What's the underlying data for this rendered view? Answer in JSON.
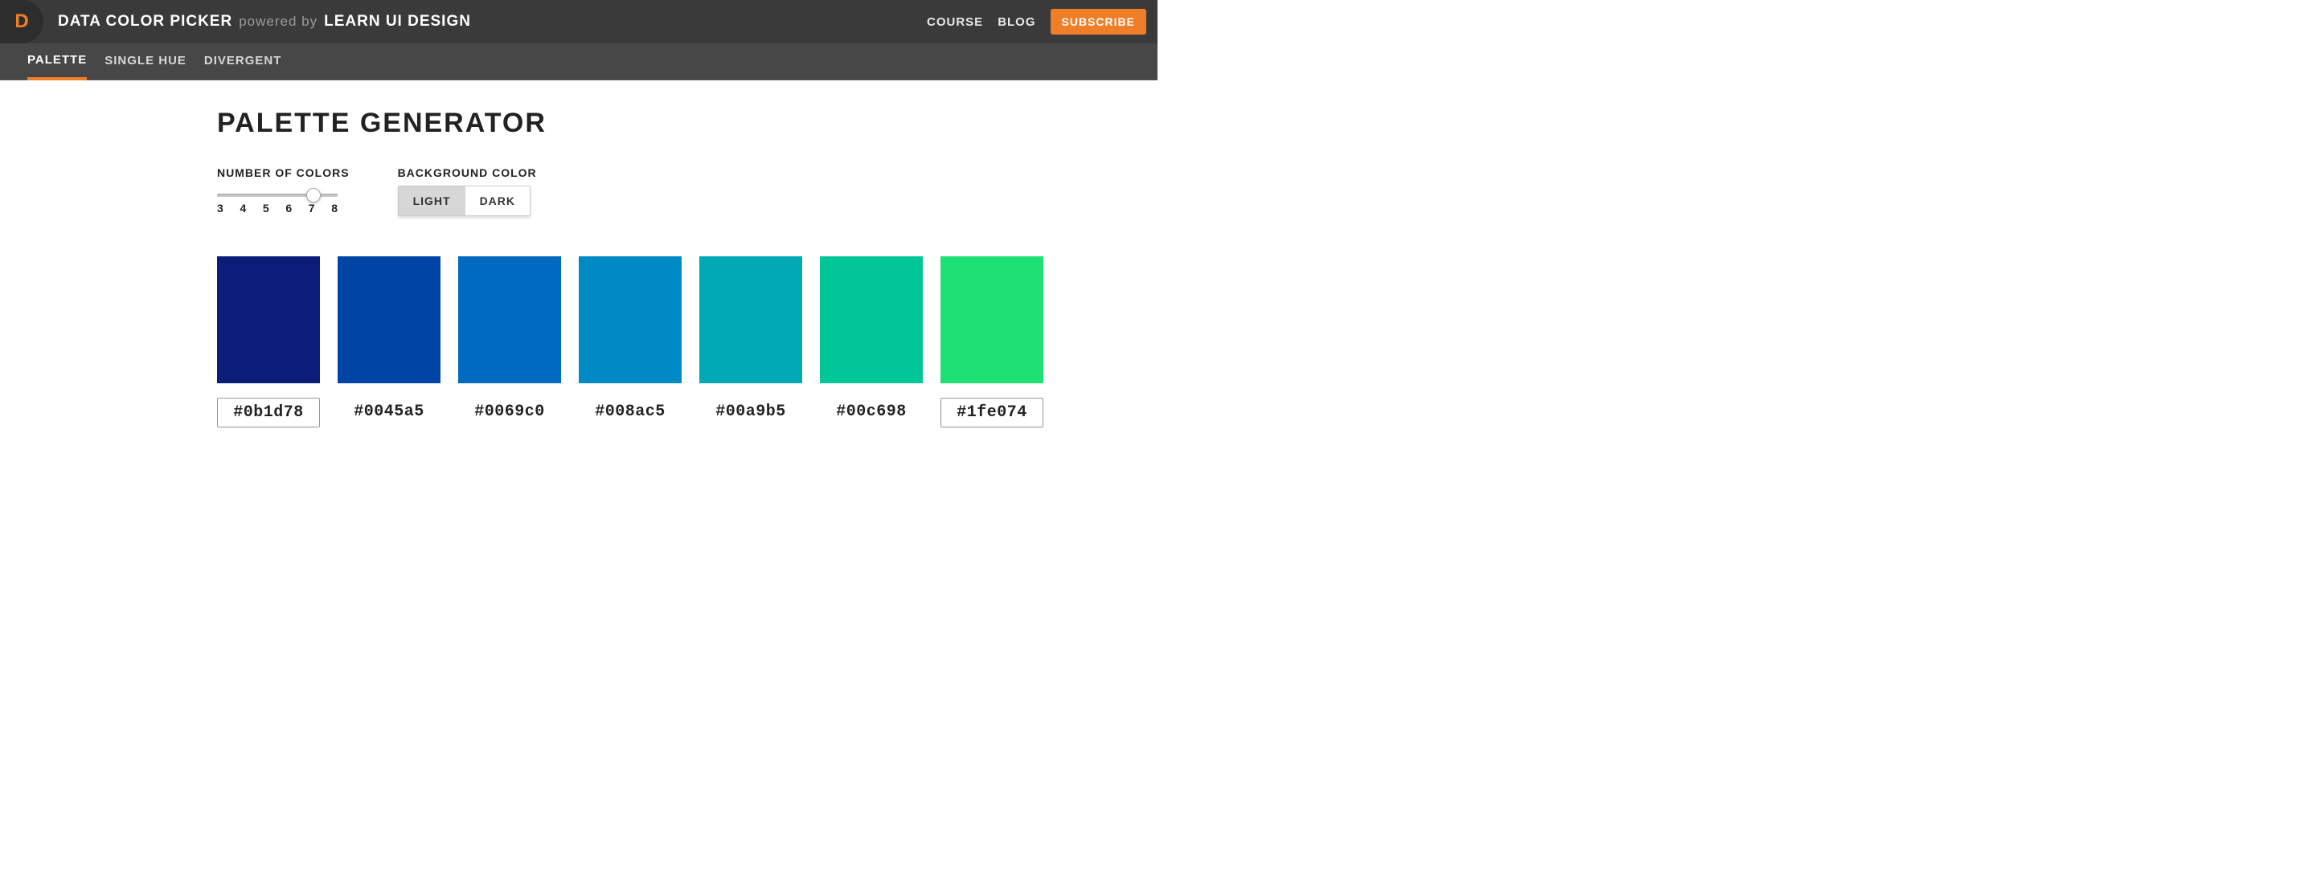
{
  "header": {
    "logo_letter": "D",
    "title": "DATA COLOR PICKER",
    "powered": "powered by",
    "by": "LEARN UI DESIGN",
    "links": {
      "course": "COURSE",
      "blog": "BLOG"
    },
    "subscribe": "SUBSCRIBE"
  },
  "tabs": {
    "palette": "PALETTE",
    "single_hue": "SINGLE HUE",
    "divergent": "DIVERGENT",
    "active": "palette"
  },
  "page": {
    "heading": "PALETTE GENERATOR"
  },
  "controls": {
    "num_colors_label": "NUMBER OF COLORS",
    "num_colors_value": 7,
    "tick_labels": [
      "3",
      "4",
      "5",
      "6",
      "7",
      "8"
    ],
    "bg_label": "BACKGROUND COLOR",
    "bg_light": "LIGHT",
    "bg_dark": "DARK",
    "bg_selected": "light"
  },
  "palette": [
    {
      "hex": "#0b1d78",
      "editable": true
    },
    {
      "hex": "#0045a5",
      "editable": false
    },
    {
      "hex": "#0069c0",
      "editable": false
    },
    {
      "hex": "#008ac5",
      "editable": false
    },
    {
      "hex": "#00a9b5",
      "editable": false
    },
    {
      "hex": "#00c698",
      "editable": false
    },
    {
      "hex": "#1fe074",
      "editable": true
    }
  ]
}
